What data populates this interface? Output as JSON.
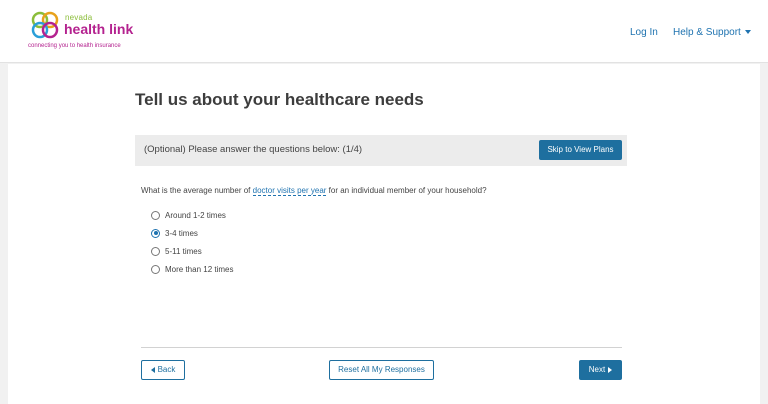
{
  "header": {
    "logo_small": "nevada",
    "logo_big": "health link",
    "logo_tagline": "connecting you to health insurance",
    "nav": {
      "login": "Log In",
      "help": "Help & Support"
    }
  },
  "page": {
    "title": "Tell us about your healthcare needs"
  },
  "question": {
    "step_text": "(Optional) Please answer the questions below: (1/4)",
    "skip_label": "Skip to View Plans",
    "prompt_before": "What is the average number of ",
    "prompt_link": "doctor visits per year",
    "prompt_after": " for an individual member of your household?",
    "options": [
      {
        "label": "Around 1-2 times",
        "selected": false
      },
      {
        "label": "3-4 times",
        "selected": true
      },
      {
        "label": "5-11 times",
        "selected": false
      },
      {
        "label": "More than 12 times",
        "selected": false
      }
    ]
  },
  "footer": {
    "back_label": "Back",
    "reset_label": "Reset All My Responses",
    "next_label": "Next"
  },
  "colors": {
    "brand_magenta": "#b4228f",
    "brand_green": "#8bbd3a",
    "accent_blue": "#1e6f9f",
    "link_blue": "#1f73b0"
  }
}
